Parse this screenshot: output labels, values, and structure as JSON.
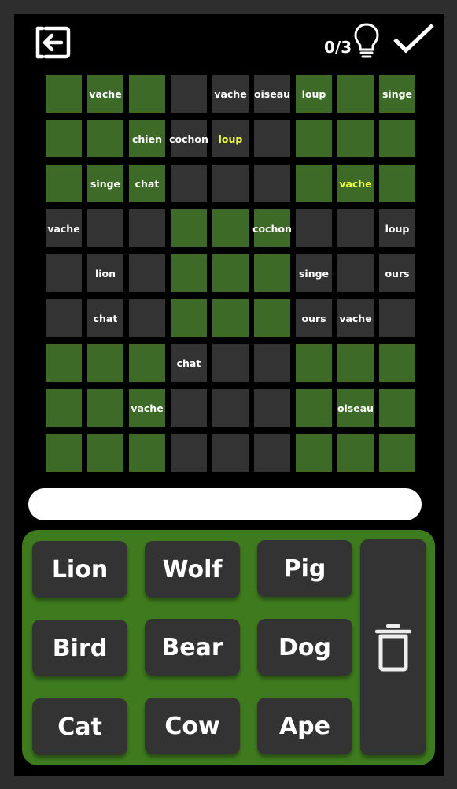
{
  "colors": {
    "green": "#3d6a26",
    "dark": "#333333",
    "highlight": "#f0ff3a",
    "keypad": "#3e7a1e"
  },
  "header": {
    "hint_count": "0/3"
  },
  "icons": {
    "exit": "exit-icon",
    "hint": "lightbulb-icon",
    "submit": "check-icon",
    "delete": "trash-icon"
  },
  "grid": {
    "rows": [
      [
        {
          "c": "g",
          "t": ""
        },
        {
          "c": "g",
          "t": "vache"
        },
        {
          "c": "g",
          "t": ""
        },
        {
          "c": "d",
          "t": ""
        },
        {
          "c": "d",
          "t": "vache"
        },
        {
          "c": "d",
          "t": "oiseau"
        },
        {
          "c": "g",
          "t": "loup"
        },
        {
          "c": "g",
          "t": ""
        },
        {
          "c": "g",
          "t": "singe"
        }
      ],
      [
        {
          "c": "g",
          "t": ""
        },
        {
          "c": "g",
          "t": ""
        },
        {
          "c": "g",
          "t": "chien"
        },
        {
          "c": "d",
          "t": "cochon"
        },
        {
          "c": "d",
          "t": "loup",
          "h": true
        },
        {
          "c": "d",
          "t": ""
        },
        {
          "c": "g",
          "t": ""
        },
        {
          "c": "g",
          "t": ""
        },
        {
          "c": "g",
          "t": ""
        }
      ],
      [
        {
          "c": "g",
          "t": ""
        },
        {
          "c": "g",
          "t": "singe"
        },
        {
          "c": "g",
          "t": "chat"
        },
        {
          "c": "d",
          "t": ""
        },
        {
          "c": "d",
          "t": ""
        },
        {
          "c": "d",
          "t": ""
        },
        {
          "c": "g",
          "t": ""
        },
        {
          "c": "g",
          "t": "vache",
          "h": true
        },
        {
          "c": "g",
          "t": ""
        }
      ],
      [
        {
          "c": "d",
          "t": "vache"
        },
        {
          "c": "d",
          "t": ""
        },
        {
          "c": "d",
          "t": ""
        },
        {
          "c": "g",
          "t": ""
        },
        {
          "c": "g",
          "t": ""
        },
        {
          "c": "g",
          "t": "cochon"
        },
        {
          "c": "d",
          "t": ""
        },
        {
          "c": "d",
          "t": ""
        },
        {
          "c": "d",
          "t": "loup"
        }
      ],
      [
        {
          "c": "d",
          "t": ""
        },
        {
          "c": "d",
          "t": "lion"
        },
        {
          "c": "d",
          "t": ""
        },
        {
          "c": "g",
          "t": ""
        },
        {
          "c": "g",
          "t": ""
        },
        {
          "c": "g",
          "t": ""
        },
        {
          "c": "d",
          "t": "singe"
        },
        {
          "c": "d",
          "t": ""
        },
        {
          "c": "d",
          "t": "ours"
        }
      ],
      [
        {
          "c": "d",
          "t": ""
        },
        {
          "c": "d",
          "t": "chat"
        },
        {
          "c": "d",
          "t": ""
        },
        {
          "c": "g",
          "t": ""
        },
        {
          "c": "g",
          "t": ""
        },
        {
          "c": "g",
          "t": ""
        },
        {
          "c": "d",
          "t": "ours"
        },
        {
          "c": "d",
          "t": "vache"
        },
        {
          "c": "d",
          "t": ""
        }
      ],
      [
        {
          "c": "g",
          "t": ""
        },
        {
          "c": "g",
          "t": ""
        },
        {
          "c": "g",
          "t": ""
        },
        {
          "c": "d",
          "t": "chat"
        },
        {
          "c": "d",
          "t": ""
        },
        {
          "c": "d",
          "t": ""
        },
        {
          "c": "g",
          "t": ""
        },
        {
          "c": "g",
          "t": ""
        },
        {
          "c": "g",
          "t": ""
        }
      ],
      [
        {
          "c": "g",
          "t": ""
        },
        {
          "c": "g",
          "t": ""
        },
        {
          "c": "g",
          "t": "vache"
        },
        {
          "c": "d",
          "t": ""
        },
        {
          "c": "d",
          "t": ""
        },
        {
          "c": "d",
          "t": ""
        },
        {
          "c": "g",
          "t": ""
        },
        {
          "c": "g",
          "t": "oiseau"
        },
        {
          "c": "g",
          "t": ""
        }
      ],
      [
        {
          "c": "g",
          "t": ""
        },
        {
          "c": "g",
          "t": ""
        },
        {
          "c": "g",
          "t": ""
        },
        {
          "c": "d",
          "t": ""
        },
        {
          "c": "d",
          "t": ""
        },
        {
          "c": "d",
          "t": ""
        },
        {
          "c": "g",
          "t": ""
        },
        {
          "c": "g",
          "t": ""
        },
        {
          "c": "g",
          "t": ""
        }
      ]
    ]
  },
  "answer": {
    "value": ""
  },
  "keypad": {
    "keys": [
      [
        "Lion",
        "Wolf",
        "Pig"
      ],
      [
        "Bird",
        "Bear",
        "Dog"
      ],
      [
        "Cat",
        "Cow",
        "Ape"
      ]
    ]
  }
}
